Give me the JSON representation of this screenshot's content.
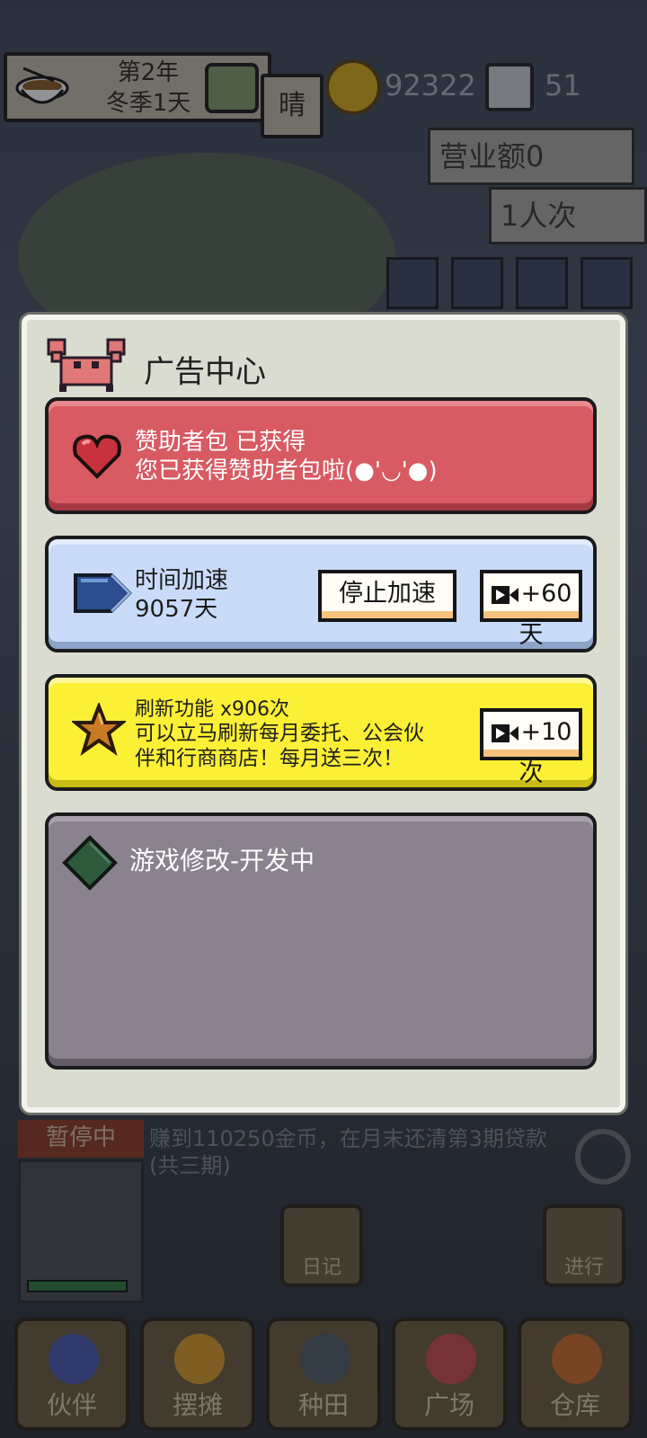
{
  "hud": {
    "date_line1": "第2年",
    "date_line2": "冬季1天",
    "weather": "晴",
    "coins": "92322",
    "gems": "51",
    "revenue": "营业额0",
    "customers": "1人次"
  },
  "status": {
    "paused": "暂停中",
    "quest": "赚到110250金币，在月末还清第3期贷款(共三期)"
  },
  "side_buttons": {
    "diary": "日记",
    "proceed": "进行"
  },
  "bottom_nav": [
    "伙伴",
    "摆摊",
    "种田",
    "广场",
    "仓库"
  ],
  "modal": {
    "title": "广告中心",
    "sponsor": {
      "title": "赞助者包 已获得",
      "desc": "您已获得赞助者包啦(●'◡'●)"
    },
    "speed": {
      "title": "时间加速",
      "days": "9057天",
      "stop_button": "停止加速",
      "ad_button": "+60天"
    },
    "refresh": {
      "title": "刷新功能 x906次",
      "desc_line1": "可以立马刷新每月委托、公会伙",
      "desc_line2": "伴和行商商店！每月送三次！",
      "ad_button": "+10次"
    },
    "mod": {
      "title": "游戏修改-开发中"
    }
  },
  "colors": {
    "sponsor_card": "#d85a62",
    "speed_card": "#c9dbf8",
    "refresh_card": "#fbf036",
    "mod_card": "#8a828e",
    "modal_bg": "#d9dccf"
  },
  "icons": [
    "crab-icon",
    "heart-icon",
    "fast-forward-icon",
    "star-icon",
    "diamond-icon",
    "video-ad-icon",
    "gear-icon",
    "coin-icon"
  ]
}
